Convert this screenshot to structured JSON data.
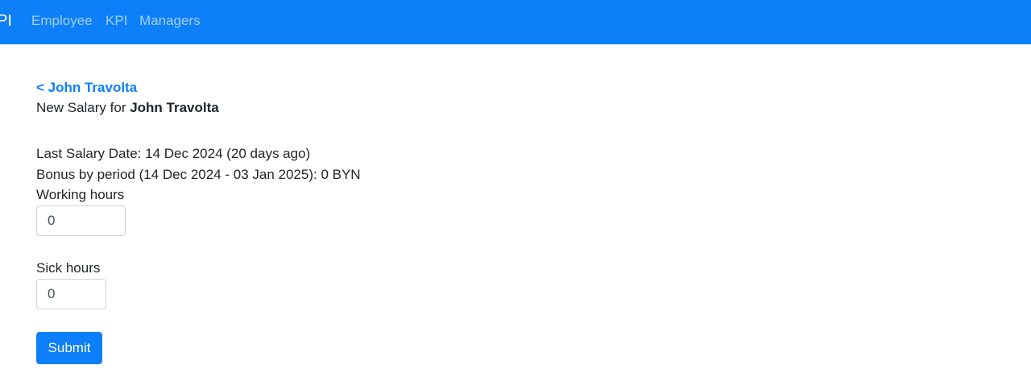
{
  "navbar": {
    "brand": "PI",
    "links": [
      "Employee",
      "KPI",
      "Managers"
    ]
  },
  "back_link": "< John Travolta",
  "heading": {
    "prefix": "New Salary for ",
    "name": "John Travolta"
  },
  "info": {
    "last_salary": "Last Salary Date: 14 Dec 2024 (20 days ago)",
    "bonus": "Bonus by period (14 Dec 2024 - 03 Jan 2025): 0 BYN"
  },
  "form": {
    "working_hours_label": "Working hours",
    "working_hours_value": "0",
    "sick_hours_label": "Sick hours",
    "sick_hours_value": "0",
    "submit_label": "Submit"
  },
  "colors": {
    "primary": "#0d7ff8",
    "nav_link": "rgba(255,255,255,0.62)"
  }
}
